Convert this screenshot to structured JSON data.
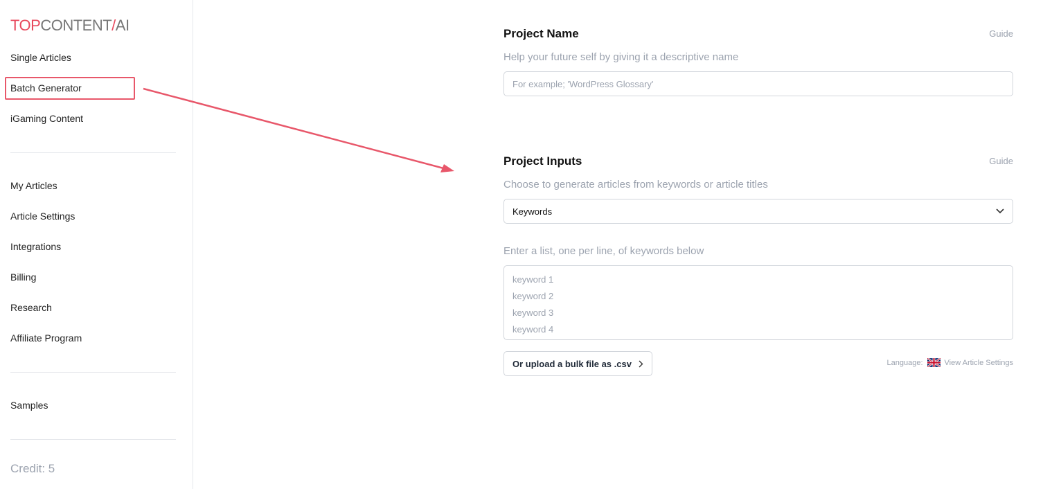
{
  "logo": {
    "part1": "TOP",
    "part2": "CONTENT",
    "slash": "/",
    "part3": "AI"
  },
  "sidebar": {
    "items": [
      {
        "label": "Single Articles"
      },
      {
        "label": "Batch Generator"
      },
      {
        "label": "iGaming Content"
      },
      {
        "label": "My Articles"
      },
      {
        "label": "Article Settings"
      },
      {
        "label": "Integrations"
      },
      {
        "label": "Billing"
      },
      {
        "label": "Research"
      },
      {
        "label": "Affiliate Program"
      },
      {
        "label": "Samples"
      }
    ],
    "credit": "Credit: 5"
  },
  "project_name": {
    "title": "Project Name",
    "guide": "Guide",
    "subtitle": "Help your future self by giving it a descriptive name",
    "placeholder": "For example; 'WordPress Glossary'"
  },
  "project_inputs": {
    "title": "Project Inputs",
    "guide": "Guide",
    "subtitle": "Choose to generate articles from keywords or article titles",
    "select_value": "Keywords",
    "list_label": "Enter a list, one per line, of keywords below",
    "list_placeholder": [
      "keyword 1",
      "keyword 2",
      "keyword 3",
      "keyword 4"
    ],
    "upload_label": "Or upload a bulk file as .csv",
    "language_label": "Language:",
    "language_icon": "uk-flag-icon",
    "settings_link": "View Article Settings"
  },
  "annotation_color": "#e8576a"
}
